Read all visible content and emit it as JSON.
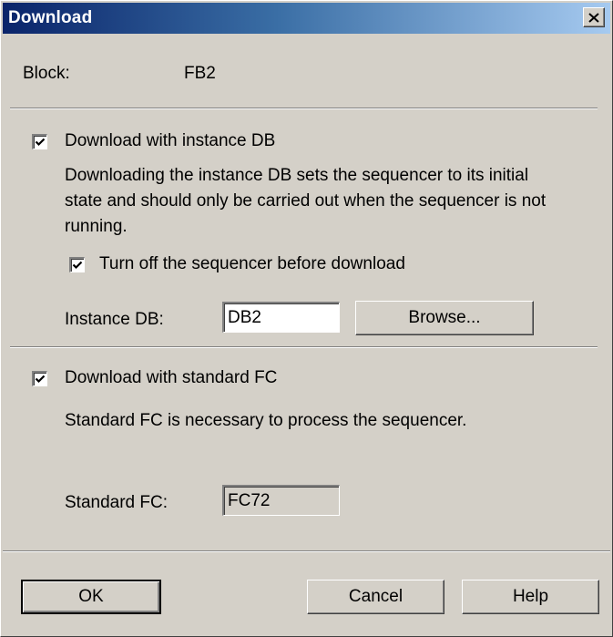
{
  "window": {
    "title": "Download",
    "close_icon": "close-icon"
  },
  "block": {
    "label": "Block:",
    "value": "FB2"
  },
  "instance_section": {
    "checkbox_label": "Download with instance DB",
    "checked": true,
    "description_lines": [
      "Downloading the instance DB sets the sequencer to its initial",
      "state and should only be carried out when the sequencer is not",
      "running."
    ],
    "turnoff_label": "Turn off the sequencer before download",
    "turnoff_checked": true,
    "instance_db_label": "Instance DB:",
    "instance_db_value": "DB2",
    "browse_label": "Browse..."
  },
  "standard_section": {
    "checkbox_label": "Download with standard FC",
    "checked": true,
    "description": "Standard FC is necessary to process the sequencer.",
    "standard_fc_label": "Standard FC:",
    "standard_fc_value": "FC72"
  },
  "buttons": {
    "ok": "OK",
    "cancel": "Cancel",
    "help": "Help"
  }
}
